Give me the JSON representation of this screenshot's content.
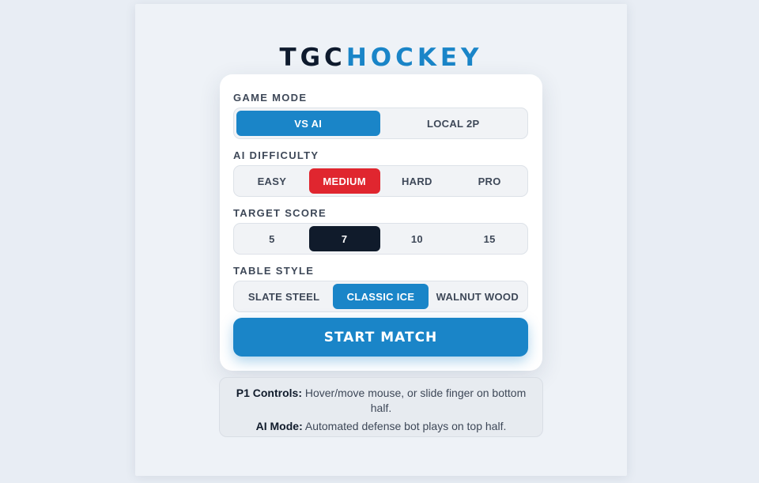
{
  "logo": {
    "part1": "TGC",
    "part2": "HOCKEY"
  },
  "game_mode": {
    "label": "GAME MODE",
    "options": [
      "VS AI",
      "LOCAL 2P"
    ],
    "selected": "VS AI"
  },
  "ai_difficulty": {
    "label": "AI DIFFICULTY",
    "options": [
      "EASY",
      "MEDIUM",
      "HARD",
      "PRO"
    ],
    "selected": "MEDIUM"
  },
  "target_score": {
    "label": "TARGET SCORE",
    "options": [
      "5",
      "7",
      "10",
      "15"
    ],
    "selected": "7"
  },
  "table_style": {
    "label": "TABLE STYLE",
    "options": [
      "SLATE STEEL",
      "CLASSIC ICE",
      "WALNUT WOOD"
    ],
    "selected": "CLASSIC ICE"
  },
  "start_button": "START MATCH",
  "info": {
    "p1_title": "P1 Controls:",
    "p1_text": " Hover/move mouse, or slide finger on bottom half.",
    "ai_title": "AI Mode:",
    "ai_text": " Automated defense bot plays on top half."
  },
  "colors": {
    "accent_blue": "#1a85c8",
    "accent_red": "#e0262f",
    "dark_navy": "#101b2b"
  }
}
